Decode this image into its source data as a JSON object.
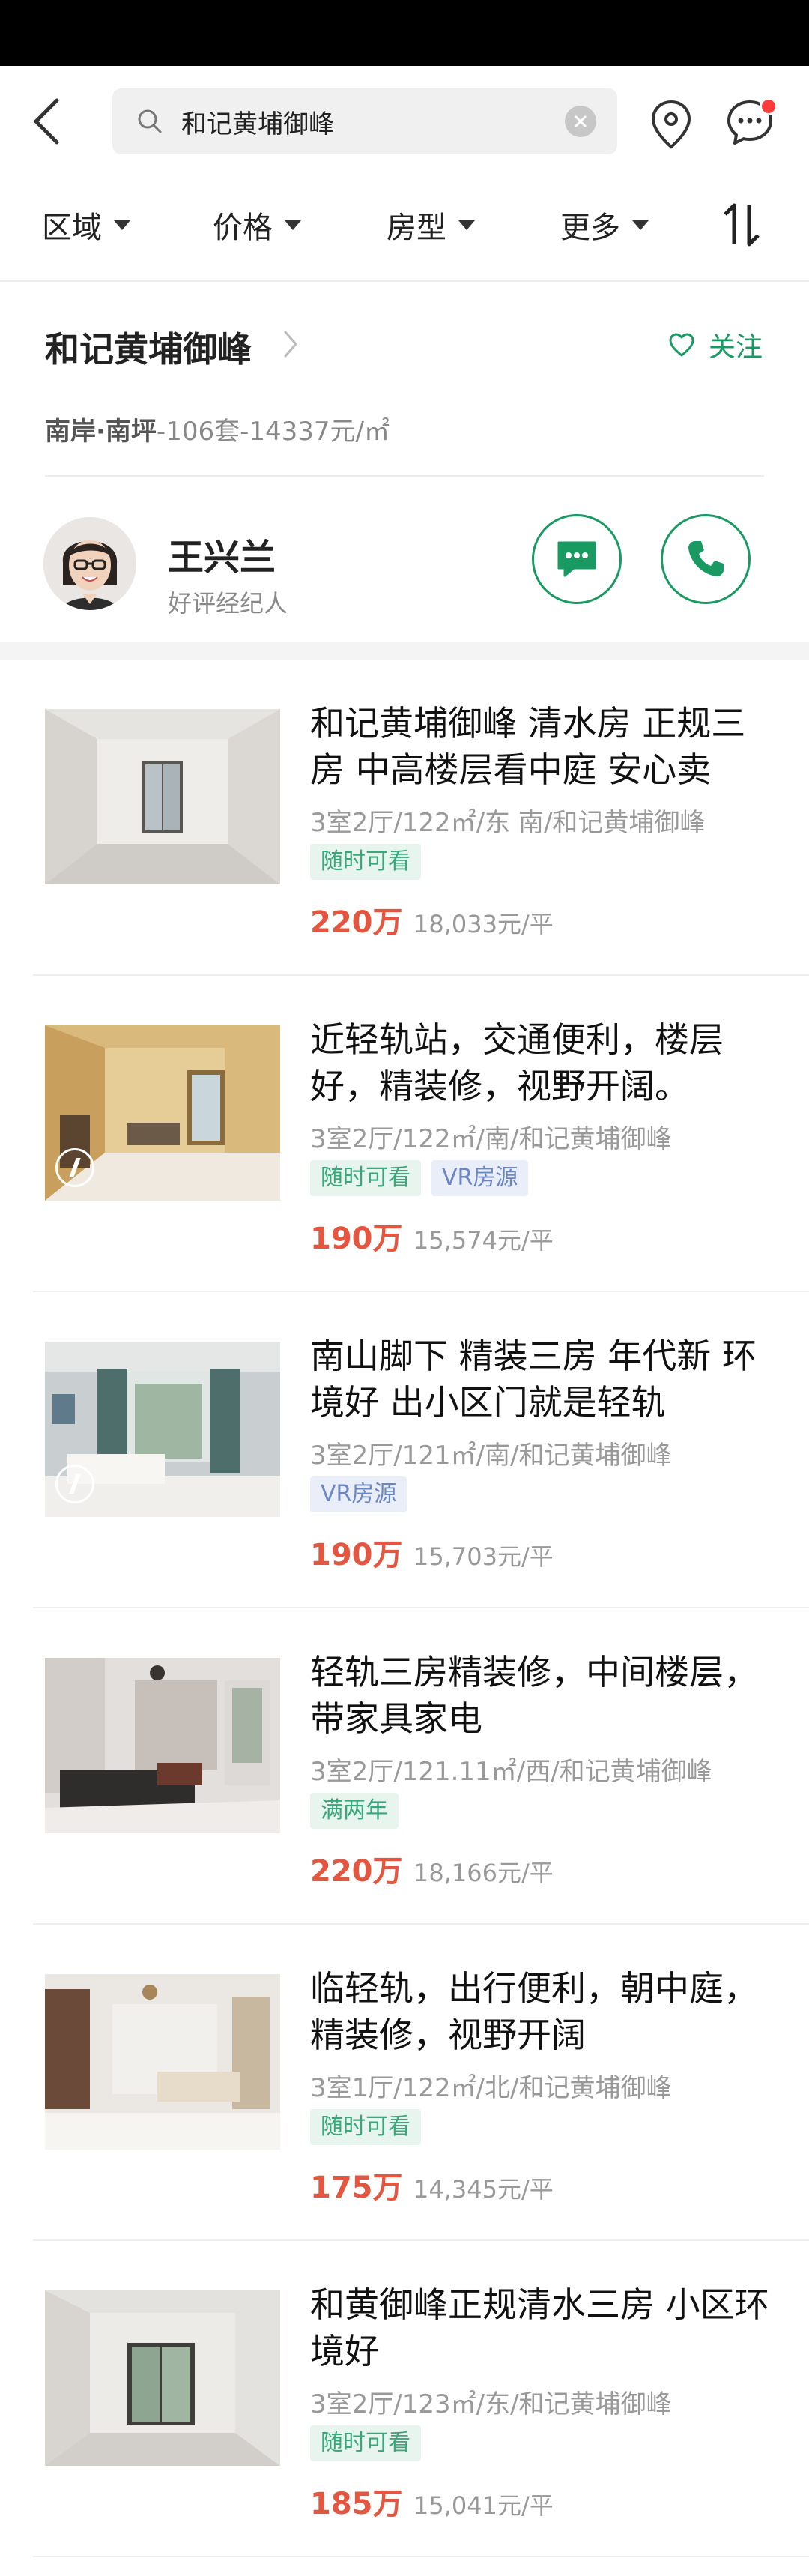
{
  "search": {
    "query": "和记黄埔御峰"
  },
  "filters": [
    {
      "label": "区域"
    },
    {
      "label": "价格"
    },
    {
      "label": "房型"
    },
    {
      "label": "更多"
    }
  ],
  "community": {
    "name": "和记黄埔御峰",
    "follow_label": "关注",
    "area": "南岸·南坪",
    "stats": "-106套-14337元/㎡"
  },
  "agent": {
    "name": "王兴兰",
    "role": "好评经纪人"
  },
  "colors": {
    "accent": "#1a9a63",
    "price": "#e4563f"
  },
  "listings": [
    {
      "title": "和记黄埔御峰 清水房 正规三房 中高楼层看中庭 安心卖",
      "meta": "3室2厅/122㎡/东 南/和记黄埔御峰",
      "tags": [
        "随时可看"
      ],
      "price": "220万",
      "unit_price": "18,033元/平"
    },
    {
      "title": "近轻轨站，交通便利，楼层好，精装修，视野开阔。",
      "meta": "3室2厅/122㎡/南/和记黄埔御峰",
      "tags": [
        "随时可看",
        "VR房源"
      ],
      "price": "190万",
      "unit_price": "15,574元/平"
    },
    {
      "title": "南山脚下 精装三房 年代新 环境好 出小区门就是轻轨",
      "meta": "3室2厅/121㎡/南/和记黄埔御峰",
      "tags": [
        "VR房源"
      ],
      "price": "190万",
      "unit_price": "15,703元/平"
    },
    {
      "title": "轻轨三房精装修，中间楼层，带家具家电",
      "meta": "3室2厅/121.11㎡/西/和记黄埔御峰",
      "tags": [
        "满两年"
      ],
      "price": "220万",
      "unit_price": "18,166元/平"
    },
    {
      "title": "临轻轨，出行便利，朝中庭，精装修，视野开阔",
      "meta": "3室1厅/122㎡/北/和记黄埔御峰",
      "tags": [
        "随时可看"
      ],
      "price": "175万",
      "unit_price": "14,345元/平"
    },
    {
      "title": "和黄御峰正规清水三房 小区环境好",
      "meta": "3室2厅/123㎡/东/和记黄埔御峰",
      "tags": [
        "随时可看"
      ],
      "price": "185万",
      "unit_price": "15,041元/平"
    }
  ]
}
